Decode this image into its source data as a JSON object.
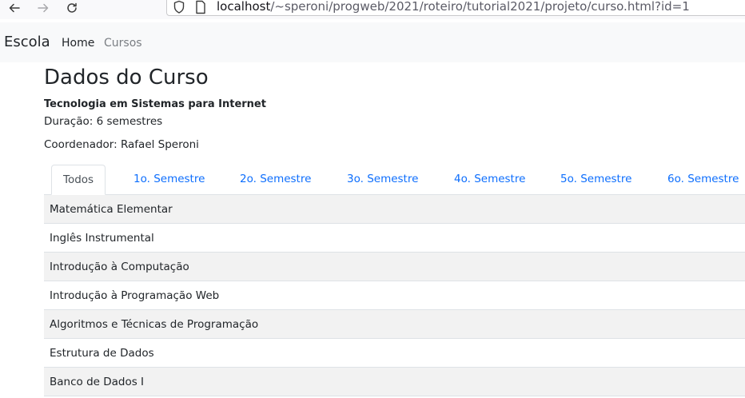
{
  "browser": {
    "url_host": "localhost",
    "url_path": "/~speroni/progweb/2021/roteiro/tutorial2021/projeto/curso.html?id=1"
  },
  "navbar": {
    "brand": "Escola",
    "links": [
      {
        "label": "Home"
      },
      {
        "label": "Cursos"
      }
    ]
  },
  "main": {
    "title": "Dados do Curso",
    "course_name": "Tecnologia em Sistemas para Internet",
    "duration": "Duração: 6 semestres",
    "coordinator": "Coordenador: Rafael Speroni",
    "tabs": [
      {
        "label": "Todos",
        "active": true
      },
      {
        "label": "1o. Semestre"
      },
      {
        "label": "2o. Semestre"
      },
      {
        "label": "3o. Semestre"
      },
      {
        "label": "4o. Semestre"
      },
      {
        "label": "5o. Semestre"
      },
      {
        "label": "6o. Semestre"
      }
    ],
    "subjects": [
      "Matemática Elementar",
      "Inglês Instrumental",
      "Introdução à Computação",
      "Introdução à Programação Web",
      "Algoritmos e Técnicas de Programação",
      "Estrutura de Dados",
      "Banco de Dados I"
    ]
  },
  "colors": {
    "link": "#0d6efd",
    "navbar_bg": "#f8f9fa",
    "stripe_bg": "#f2f2f2"
  },
  "icons": [
    "back-arrow-icon",
    "forward-arrow-icon",
    "reload-icon",
    "shield-icon",
    "page-icon"
  ]
}
